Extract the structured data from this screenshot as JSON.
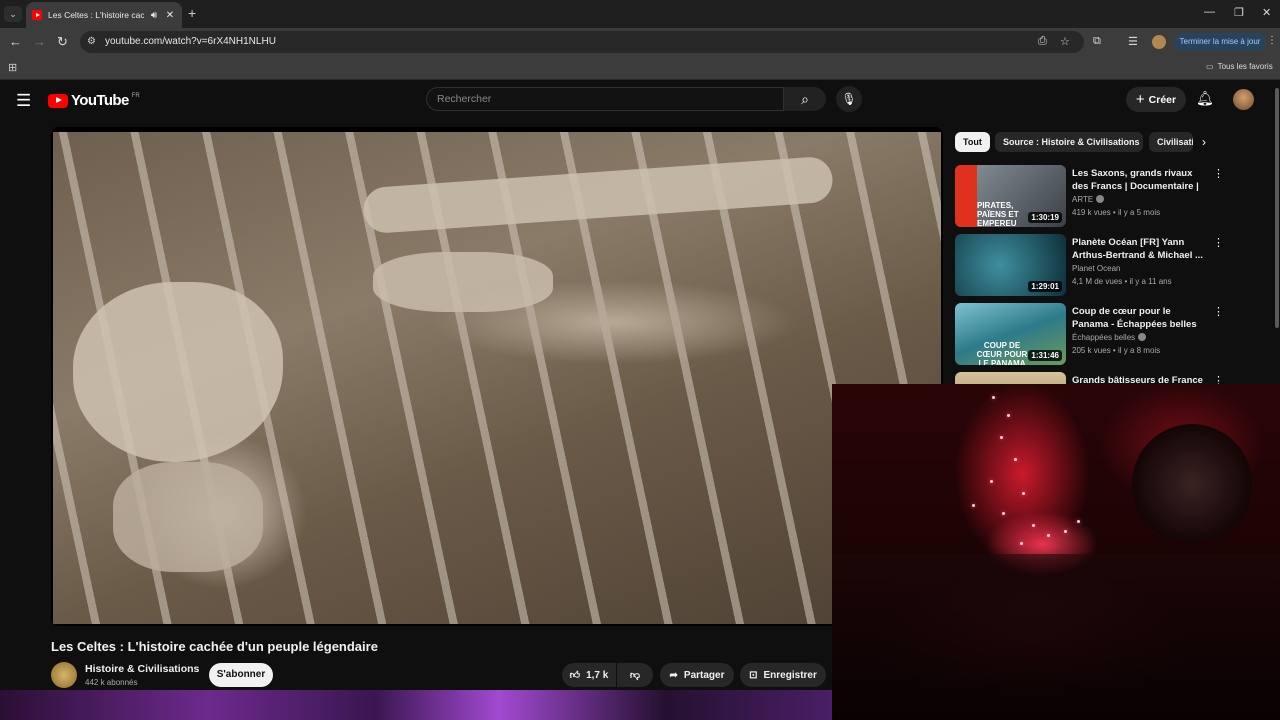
{
  "browser": {
    "tab_title": "Les Celtes : L'histoire cachée d'un peuple légendaire - YouTube",
    "url": "youtube.com/watch?v=6rX4NH1NLHU",
    "update_label": "Terminer la mise à jour",
    "bookmarks_folder": "Tous les favoris"
  },
  "youtube": {
    "logo_text": "YouTube",
    "country_code": "FR",
    "search_placeholder": "Rechercher",
    "create_label": "Créer"
  },
  "video": {
    "title": "Les Celtes : L'histoire cachée d'un peuple légendaire",
    "channel_name": "Histoire & Civilisations",
    "channel_subs": "442 k abonnés",
    "subscribe_label": "S'abonner",
    "likes": "1,7 k",
    "share_label": "Partager",
    "save_label": "Enregistrer"
  },
  "chips": [
    "Tout",
    "Source : Histoire & Civilisations",
    "Civilisations"
  ],
  "recommendations": [
    {
      "title": "Les Saxons, grands rivaux des Francs | Documentaire | ARTE",
      "channel": "ARTE",
      "verified": true,
      "meta": "419 k vues • il y a 5 mois",
      "duration": "1:30:19",
      "thumb_text": "PIRATES, PAÏENS ET EMPEREU",
      "thumb_color": "#5a5f66"
    },
    {
      "title": "Planète Océan [FR] Yann Arthus-Bertrand & Michael ...",
      "channel": "Planet Ocean",
      "verified": false,
      "meta": "4,1 M de vues • il y a 11 ans",
      "duration": "1:29:01",
      "thumb_text": "",
      "thumb_color": "#1d5a6a"
    },
    {
      "title": "Coup de cœur pour le Panama - Échappées belles",
      "channel": "Échappées belles",
      "verified": true,
      "meta": "205 k vues • il y a 8 mois",
      "duration": "1:31:46",
      "thumb_text": "COUP DE CŒUR POUR LE PANAMA",
      "thumb_color": "#2f7f8f"
    },
    {
      "title": "Grands bâtisseurs de France :",
      "channel": "",
      "verified": false,
      "meta": "",
      "duration": "",
      "thumb_text": "",
      "thumb_color": "#b8a070"
    }
  ],
  "colors": {
    "yt_red": "#ff0000",
    "background": "#0f0f0f",
    "update_button": "#28435c"
  }
}
